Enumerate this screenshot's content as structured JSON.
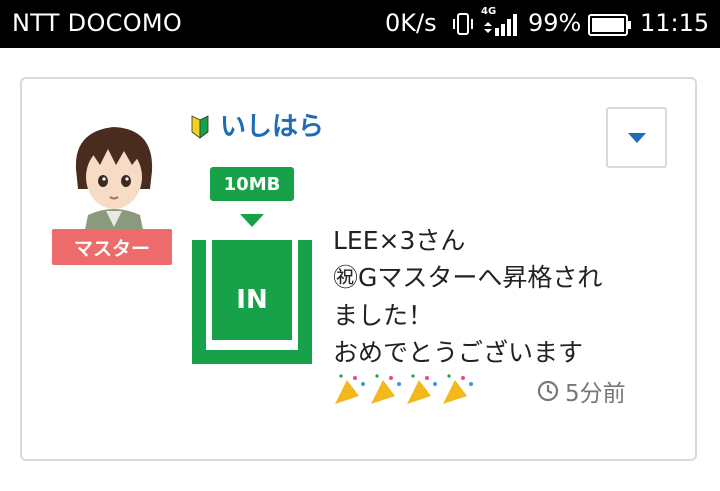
{
  "status_bar": {
    "carrier": "NTT DOCOMO",
    "net_speed": "0K/s",
    "network_type": "4G",
    "battery_percent": "99%",
    "time": "11:15",
    "icons": [
      "vibrate-icon",
      "signal-icon",
      "battery-icon"
    ]
  },
  "post": {
    "avatar": "avatar",
    "rank_badge": "マスター",
    "username": "いしはら",
    "beginner_mark_icon": "beginner-mark-icon",
    "dropdown_icon": "caret-down-icon",
    "data_badge": "10MB",
    "stamp_label": "IN",
    "message": "LEE×3さん\n㊗Gマスターへ昇格され\nました！\nおめでとうございます",
    "emoji_icons": [
      "party-popper-icon",
      "party-popper-icon",
      "party-popper-icon",
      "party-popper-icon"
    ],
    "timestamp": "5分前",
    "colors": {
      "accent_green": "#17a24a",
      "username_blue": "#1e6bb8",
      "badge_red": "#ee6b6b",
      "dropdown_blue": "#1e6bb8"
    }
  }
}
